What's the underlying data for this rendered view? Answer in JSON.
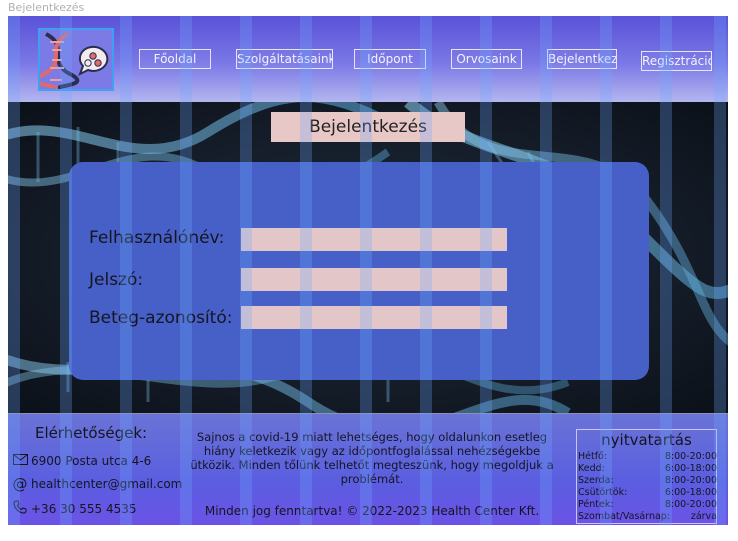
{
  "window": {
    "title": "Bejelentkezés"
  },
  "nav": {
    "items": [
      {
        "label": "Főoldal"
      },
      {
        "label": "Szolgáltatásaink"
      },
      {
        "label": "Időpont"
      },
      {
        "label": "Orvosaink"
      },
      {
        "label": "Bejelentkezés"
      },
      {
        "label": "Regisztráció"
      }
    ]
  },
  "login": {
    "title": "Bejelentkezés",
    "username_label": "Felhasználónév:",
    "password_label": "Jelszó:",
    "patient_id_label": "Beteg-azonosító:",
    "username_value": "",
    "password_value": "",
    "patient_id_value": ""
  },
  "footer": {
    "contact_title": "Elérhetőségek:",
    "address": "6900 Posta utca 4-6",
    "email": "healthcenter@gmail.com",
    "phone": "+36 30 555 4535",
    "notice": "Sajnos a covid-19 miatt lehetséges, hogy oldalunkon esetleg hiány keletkezik vagy az időpontfoglalással nehézségekbe ütközik. Minden tőlünk telhetőt megteszünk, hogy megoldjuk a problémát.",
    "copyright": "Minden jog fenntartva! © 2022-2023 Health Center Kft.",
    "hours_title": "nyitvatartás",
    "hours": [
      {
        "day": "Hétfő:",
        "time": "8:00-20:00"
      },
      {
        "day": "Kedd:",
        "time": "6:00-18:00"
      },
      {
        "day": "Szerda:",
        "time": "8:00-20:00"
      },
      {
        "day": "Csütörtök:",
        "time": "6:00-18:00"
      },
      {
        "day": "Péntek:",
        "time": "8:00-20:00"
      },
      {
        "day": "Szombat/Vasárnap:",
        "time": "zárva"
      }
    ]
  },
  "icons": {
    "logo": "dna-molecule-logo",
    "address": "envelope-icon",
    "email": "at-sign-icon",
    "phone": "phone-icon"
  },
  "colors": {
    "header": "#6a68e0",
    "card": "#4660c8",
    "input": "#e2c6c8",
    "title_box": "#e8c7c7",
    "footer": "#5a5ee0"
  }
}
